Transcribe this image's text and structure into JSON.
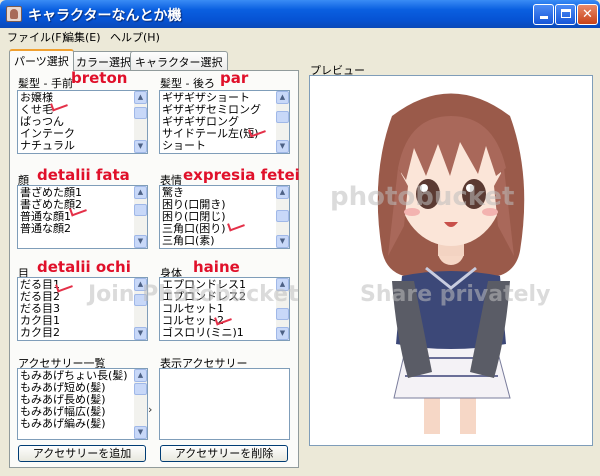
{
  "window": {
    "title": "キャラクターなんとか機"
  },
  "menu": {
    "file": "ファイル(F)",
    "edit": "編集(E)",
    "help": "ヘルプ(H)"
  },
  "tabs": {
    "parts": "パーツ選択",
    "color": "カラー選択",
    "character": "キャラクター選択"
  },
  "groups": {
    "hair_front": {
      "label": "髪型 - 手前",
      "items": [
        "お嬢様",
        "くせ毛",
        "ぱっつん",
        "インテーク",
        "ナチュラル"
      ],
      "annotation": "breton"
    },
    "hair_back": {
      "label": "髪型 - 後ろ",
      "items": [
        "ギザギザショート",
        "ギザギザセミロング",
        "ギザギザロング",
        "サイドテール左(短)",
        "ショート"
      ],
      "annotation": "par"
    },
    "face": {
      "label": "顔",
      "items": [
        "書ざめた顔1",
        "書ざめた顔2",
        "普通な顔1",
        "普通な顔2"
      ],
      "annotation": "detalii fata"
    },
    "expression": {
      "label": "表情",
      "items": [
        "驚き",
        "困り(口開き)",
        "困り(口閉じ)",
        "三角口(困り)",
        "三角口(素)"
      ],
      "annotation": "expresia fetei"
    },
    "eyes": {
      "label": "目",
      "items": [
        "だる目1",
        "だる目2",
        "だる目3",
        "カク目1",
        "カク目2"
      ],
      "annotation": "detalii ochi"
    },
    "body": {
      "label": "身体",
      "items": [
        "エプロンドレス1",
        "エプロンドレス2",
        "コルセット1",
        "コルセット2",
        "ゴスロリ(ミニ)1"
      ],
      "annotation": "haine"
    },
    "accessory_list": {
      "label": "アクセサリー一覧",
      "items": [
        "もみあげちょい長(髪)",
        "もみあげ短め(髪)",
        "もみあげ長め(髪)",
        "もみあげ幅広(髪)",
        "もみあげ編み(髪)"
      ]
    },
    "shown_accessories": {
      "label": "表示アクセサリー",
      "items": []
    }
  },
  "arrow": "›",
  "buttons": {
    "add": "アクセサリーを追加",
    "remove": "アクセサリーを削除"
  },
  "preview": {
    "label": "プレビュー"
  },
  "watermark": {
    "brand": "photobucket",
    "cta": "Join Photobucket",
    "share": "Share privately"
  },
  "colors": {
    "title_bar": "#0653d4",
    "annotation": "#e0102a",
    "tab_accent": "#f0a030"
  }
}
